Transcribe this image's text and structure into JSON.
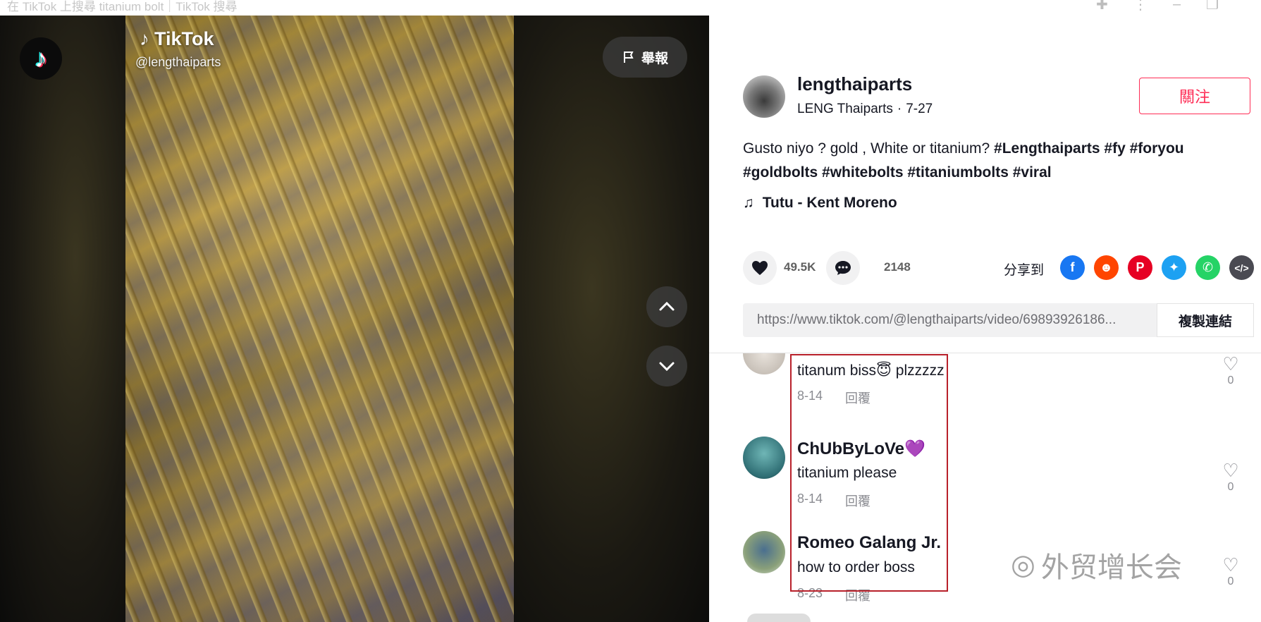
{
  "browser": {
    "tab_title": "在 TikTok 上搜尋 titanium bolt｜TikTok 搜尋"
  },
  "video": {
    "watermark_logo": "TikTok",
    "watermark_user": "@lengthaiparts",
    "report_label": "舉報"
  },
  "author": {
    "username": "lengthaiparts",
    "display_name": "LENG Thaiparts",
    "date": "7-27",
    "follow_label": "關注"
  },
  "caption": {
    "text": "Gusto niyo ? gold , White or titanium?",
    "hashtags": [
      "#Lengthaiparts",
      "#fy",
      "#foryou",
      "#goldbolts",
      "#whitebolts",
      "#titaniumbolts",
      "#viral"
    ]
  },
  "music": {
    "title": "Tutu - Kent Moreno"
  },
  "stats": {
    "likes": "49.5K",
    "comments": "2148"
  },
  "share": {
    "label": "分享到",
    "targets": [
      "facebook",
      "reddit",
      "pinterest",
      "twitter",
      "whatsapp",
      "embed"
    ],
    "colors": {
      "facebook": "#1877f2",
      "reddit": "#ff4500",
      "pinterest": "#e60023",
      "twitter": "#1da1f2",
      "whatsapp": "#25d366",
      "embed": "#4a4a52"
    }
  },
  "link": {
    "url": "https://www.tiktok.com/@lengthaiparts/video/69893926186...",
    "copy_label": "複製連結"
  },
  "comments": [
    {
      "user": "",
      "text": "titanum biss😇 plzzzzz",
      "date": "8-14",
      "reply": "回覆",
      "likes": "0"
    },
    {
      "user": "ChUbByLoVe💜",
      "text": "titanium please",
      "date": "8-14",
      "reply": "回覆",
      "likes": "0"
    },
    {
      "user": "Romeo Galang Jr.",
      "text": "how to order boss",
      "date": "8-23",
      "reply": "回覆",
      "likes": "0"
    }
  ],
  "overlay": {
    "watermark": "外贸增长会"
  }
}
